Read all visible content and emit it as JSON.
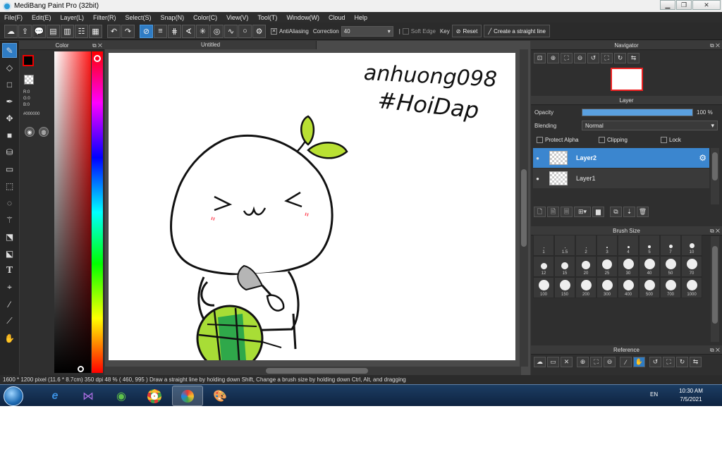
{
  "window": {
    "title": "MediBang Paint Pro (32bit)",
    "minimize_icon": "minimize-icon",
    "maximize_icon": "restore-icon",
    "close_icon": "close-icon"
  },
  "menu": [
    "File(F)",
    "Edit(E)",
    "Layer(L)",
    "Filter(R)",
    "Select(S)",
    "Snap(N)",
    "Color(C)",
    "View(V)",
    "Tool(T)",
    "Window(W)",
    "Cloud",
    "Help"
  ],
  "toolbar": {
    "antialiasing_label": "AntiAliasing",
    "antialiasing_checked": true,
    "correction_label": "Correction",
    "correction_value": "40",
    "soft_edge_label": "Soft Edge",
    "soft_edge_checked": false,
    "key_label": "Key",
    "reset_label": "Reset",
    "straight_line_label": "Create a straight line"
  },
  "document": {
    "tab_title": "Untitled"
  },
  "color_panel": {
    "title": "Color",
    "r": "R:0",
    "g": "G:0",
    "b": "B:0",
    "hex": "#000000",
    "foreground": "#000000",
    "background": "#e00000"
  },
  "navigator": {
    "title": "Navigator"
  },
  "layer_panel": {
    "title": "Layer",
    "opacity_label": "Opacity",
    "opacity_value": "100 %",
    "opacity_fraction": 1.0,
    "blending_label": "Blending",
    "blending_value": "Normal",
    "protect_alpha_label": "Protect Alpha",
    "clipping_label": "Clipping",
    "lock_label": "Lock",
    "layers": [
      {
        "name": "Layer2",
        "selected": true
      },
      {
        "name": "Layer1",
        "selected": false
      }
    ]
  },
  "brush_size": {
    "title": "Brush Size",
    "sizes": [
      "1",
      "1.5",
      "2",
      "3",
      "4",
      "5",
      "7",
      "10",
      "12",
      "15",
      "20",
      "25",
      "30",
      "40",
      "50",
      "70",
      "100",
      "150",
      "200",
      "300",
      "400",
      "500",
      "700",
      "1000"
    ]
  },
  "reference": {
    "title": "Reference"
  },
  "status": {
    "text": "1600 * 1200 pixel   (11.6 * 8.7cm)   350 dpi   48 %   ( 460, 995 )   Draw a straight line by holding down Shift, Change a brush size by holding down Ctrl, Alt, and dragging"
  },
  "canvas_text": {
    "line1": "anhuong098",
    "line2": "#HoiDap"
  },
  "taskbar": {
    "lang": "EN",
    "time": "10:30 AM",
    "date": "7/5/2021"
  },
  "colors": {
    "accent": "#2f7cc4",
    "leaf": "#b9e033",
    "ball_dark": "#2fa84a",
    "ball_light": "#a8dd36",
    "blush": "#ff4a5a"
  }
}
